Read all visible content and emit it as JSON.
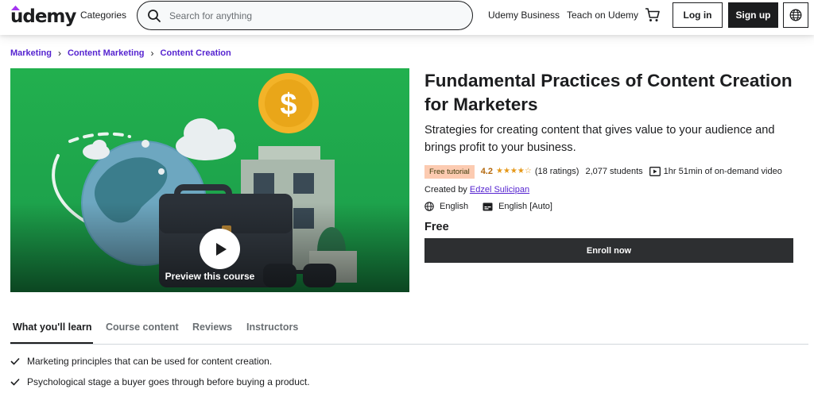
{
  "header": {
    "logo_text": "udemy",
    "categories_label": "Categories",
    "search_placeholder": "Search for anything",
    "business_link": "Udemy Business",
    "teach_link": "Teach on Udemy",
    "login_label": "Log in",
    "signup_label": "Sign up",
    "icons": [
      "search-icon",
      "cart-icon",
      "globe-icon"
    ]
  },
  "breadcrumb": [
    "Marketing",
    "Content Marketing",
    "Content Creation"
  ],
  "preview": {
    "label": "Preview this course",
    "icon": "play-icon"
  },
  "course": {
    "title": "Fundamental Practices of Content Creation for Marketers",
    "subtitle": "Strategies for creating content that gives value to your audience and brings profit to your business.",
    "badge": "Free tutorial",
    "rating": "4.2",
    "stars": 4.2,
    "ratings_count": "(18 ratings)",
    "students": "2,077 students",
    "duration": "1hr 51min of on-demand video",
    "created_by_label": "Created by",
    "instructor": "Edzel Sulicipan",
    "language": "English",
    "captions": "English [Auto]",
    "price": "Free",
    "enroll_label": "Enroll now"
  },
  "tabs": [
    {
      "label": "What you'll learn",
      "active": true
    },
    {
      "label": "Course content",
      "active": false
    },
    {
      "label": "Reviews",
      "active": false
    },
    {
      "label": "Instructors",
      "active": false
    }
  ],
  "learn_items": [
    "Marketing principles that can be used for content creation.",
    "Psychological stage a buyer goes through before buying a product."
  ],
  "colors": {
    "accent": "#5624d0",
    "dark": "#1c1d1f",
    "badge_bg": "#fccbb1",
    "star": "#e59819",
    "rating_text": "#b4690e",
    "preview_bg": "#1fa84f"
  }
}
